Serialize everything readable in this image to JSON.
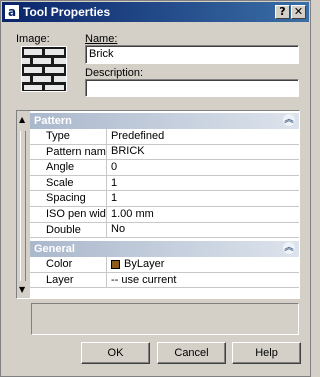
{
  "window": {
    "title": "Tool Properties",
    "app_icon": "a",
    "help_glyph": "?",
    "close_glyph": "✕"
  },
  "form": {
    "image_label": "Image:",
    "name_label": "Name:",
    "name_value": "Brick",
    "description_label": "Description:",
    "description_value": ""
  },
  "grid": {
    "sections": [
      {
        "title": "Pattern",
        "rows": [
          {
            "key": "Type",
            "value": "Predefined"
          },
          {
            "key": "Pattern name",
            "value": "BRICK"
          },
          {
            "key": "Angle",
            "value": "0"
          },
          {
            "key": "Scale",
            "value": "1"
          },
          {
            "key": "Spacing",
            "value": "1"
          },
          {
            "key": "ISO pen width",
            "value": "1.00 mm"
          },
          {
            "key": "Double",
            "value": "No"
          }
        ]
      },
      {
        "title": "General",
        "rows": [
          {
            "key": "Color",
            "value": "ByLayer",
            "swatch": "#8b5a1e"
          },
          {
            "key": "Layer",
            "value": "-- use current"
          }
        ]
      }
    ]
  },
  "buttons": {
    "ok": "OK",
    "cancel": "Cancel",
    "help": "Help"
  },
  "colors": {
    "title_start": "#0a246a",
    "title_end": "#3a6ea5",
    "section_header": "#aab8cc",
    "face": "#d4d0c8"
  }
}
